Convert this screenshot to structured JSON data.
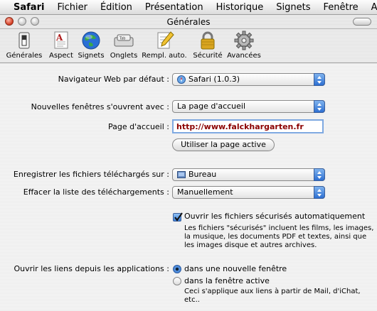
{
  "menubar": {
    "app_name": "Safari",
    "items": [
      "Fichier",
      "Édition",
      "Présentation",
      "Historique",
      "Signets",
      "Fenêtre",
      "Aide"
    ]
  },
  "window": {
    "title": "Générales"
  },
  "toolbar": {
    "items": [
      {
        "label": "Générales",
        "icon": "switch-icon"
      },
      {
        "label": "Aspect",
        "icon": "font-icon"
      },
      {
        "label": "Signets",
        "icon": "globe-icon"
      },
      {
        "label": "Onglets",
        "icon": "tab-icon"
      },
      {
        "label": "Rempl. auto.",
        "icon": "pencil-icon"
      },
      {
        "label": "Sécurité",
        "icon": "lock-icon"
      },
      {
        "label": "Avancées",
        "icon": "gear-icon"
      }
    ]
  },
  "prefs": {
    "default_browser_label": "Navigateur Web par défaut :",
    "default_browser_value": "Safari (1.0.3)",
    "new_windows_label": "Nouvelles fenêtres s'ouvrent avec :",
    "new_windows_value": "La page d'accueil",
    "homepage_label": "Page d'accueil :",
    "homepage_value": "http://www.falckhargarten.fr",
    "use_current_button": "Utiliser la page active",
    "save_downloads_label": "Enregistrer les fichiers téléchargés sur :",
    "save_downloads_value": "Bureau",
    "clear_downloads_label": "Effacer la liste des téléchargements :",
    "clear_downloads_value": "Manuellement",
    "open_safe_files_label": "Ouvrir les fichiers sécurisés automatiquement",
    "open_safe_files_checked": true,
    "safe_files_note": [
      "Les fichiers \"sécurisés\" incluent les films, les images,",
      "la musique, les documents PDF et textes, ainsi que",
      "les images disque et autres archives."
    ],
    "open_links_label": "Ouvrir les liens depuis les applications :",
    "open_links_options": [
      "dans une nouvelle fenêtre",
      "dans la fenêtre active"
    ],
    "open_links_selected": 0,
    "open_links_note": "Ceci s'applique aux liens à partir de Mail, d'iChat, etc.."
  }
}
